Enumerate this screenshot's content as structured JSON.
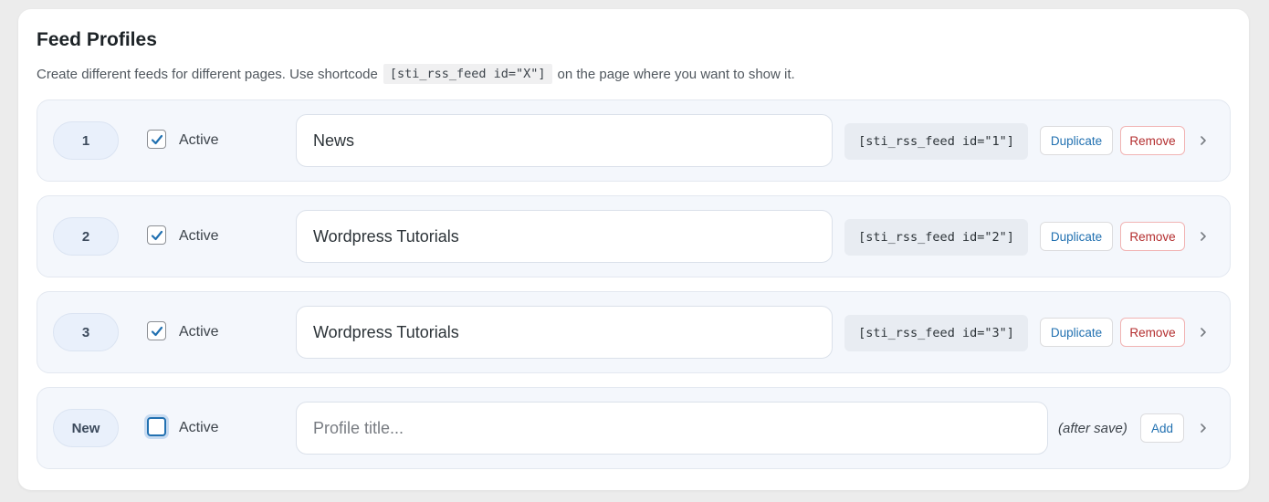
{
  "section": {
    "title": "Feed Profiles",
    "desc_before": "Create different feeds for different pages. Use shortcode",
    "desc_code": "[sti_rss_feed id=\"X\"]",
    "desc_after": "on the page where you want to show it."
  },
  "profiles": [
    {
      "number": "1",
      "active": true,
      "active_label": "Active",
      "title": "News",
      "shortcode": "[sti_rss_feed id=\"1\"]",
      "duplicate_label": "Duplicate",
      "remove_label": "Remove"
    },
    {
      "number": "2",
      "active": true,
      "active_label": "Active",
      "title": "Wordpress Tutorials",
      "shortcode": "[sti_rss_feed id=\"2\"]",
      "duplicate_label": "Duplicate",
      "remove_label": "Remove"
    },
    {
      "number": "3",
      "active": true,
      "active_label": "Active",
      "title": "Wordpress Tutorials",
      "shortcode": "[sti_rss_feed id=\"3\"]",
      "duplicate_label": "Duplicate",
      "remove_label": "Remove"
    }
  ],
  "new_profile": {
    "number": "New",
    "active": false,
    "active_label": "Active",
    "title_value": "",
    "title_placeholder": "Profile title...",
    "shortcode_note": "(after save)",
    "add_label": "Add"
  },
  "icons": {
    "checkbox": "checkmark-icon",
    "expand": "chevron-right-icon"
  },
  "colors": {
    "accent": "#2271b1",
    "danger": "#b32d2e",
    "row_bg": "#f4f7fc"
  }
}
